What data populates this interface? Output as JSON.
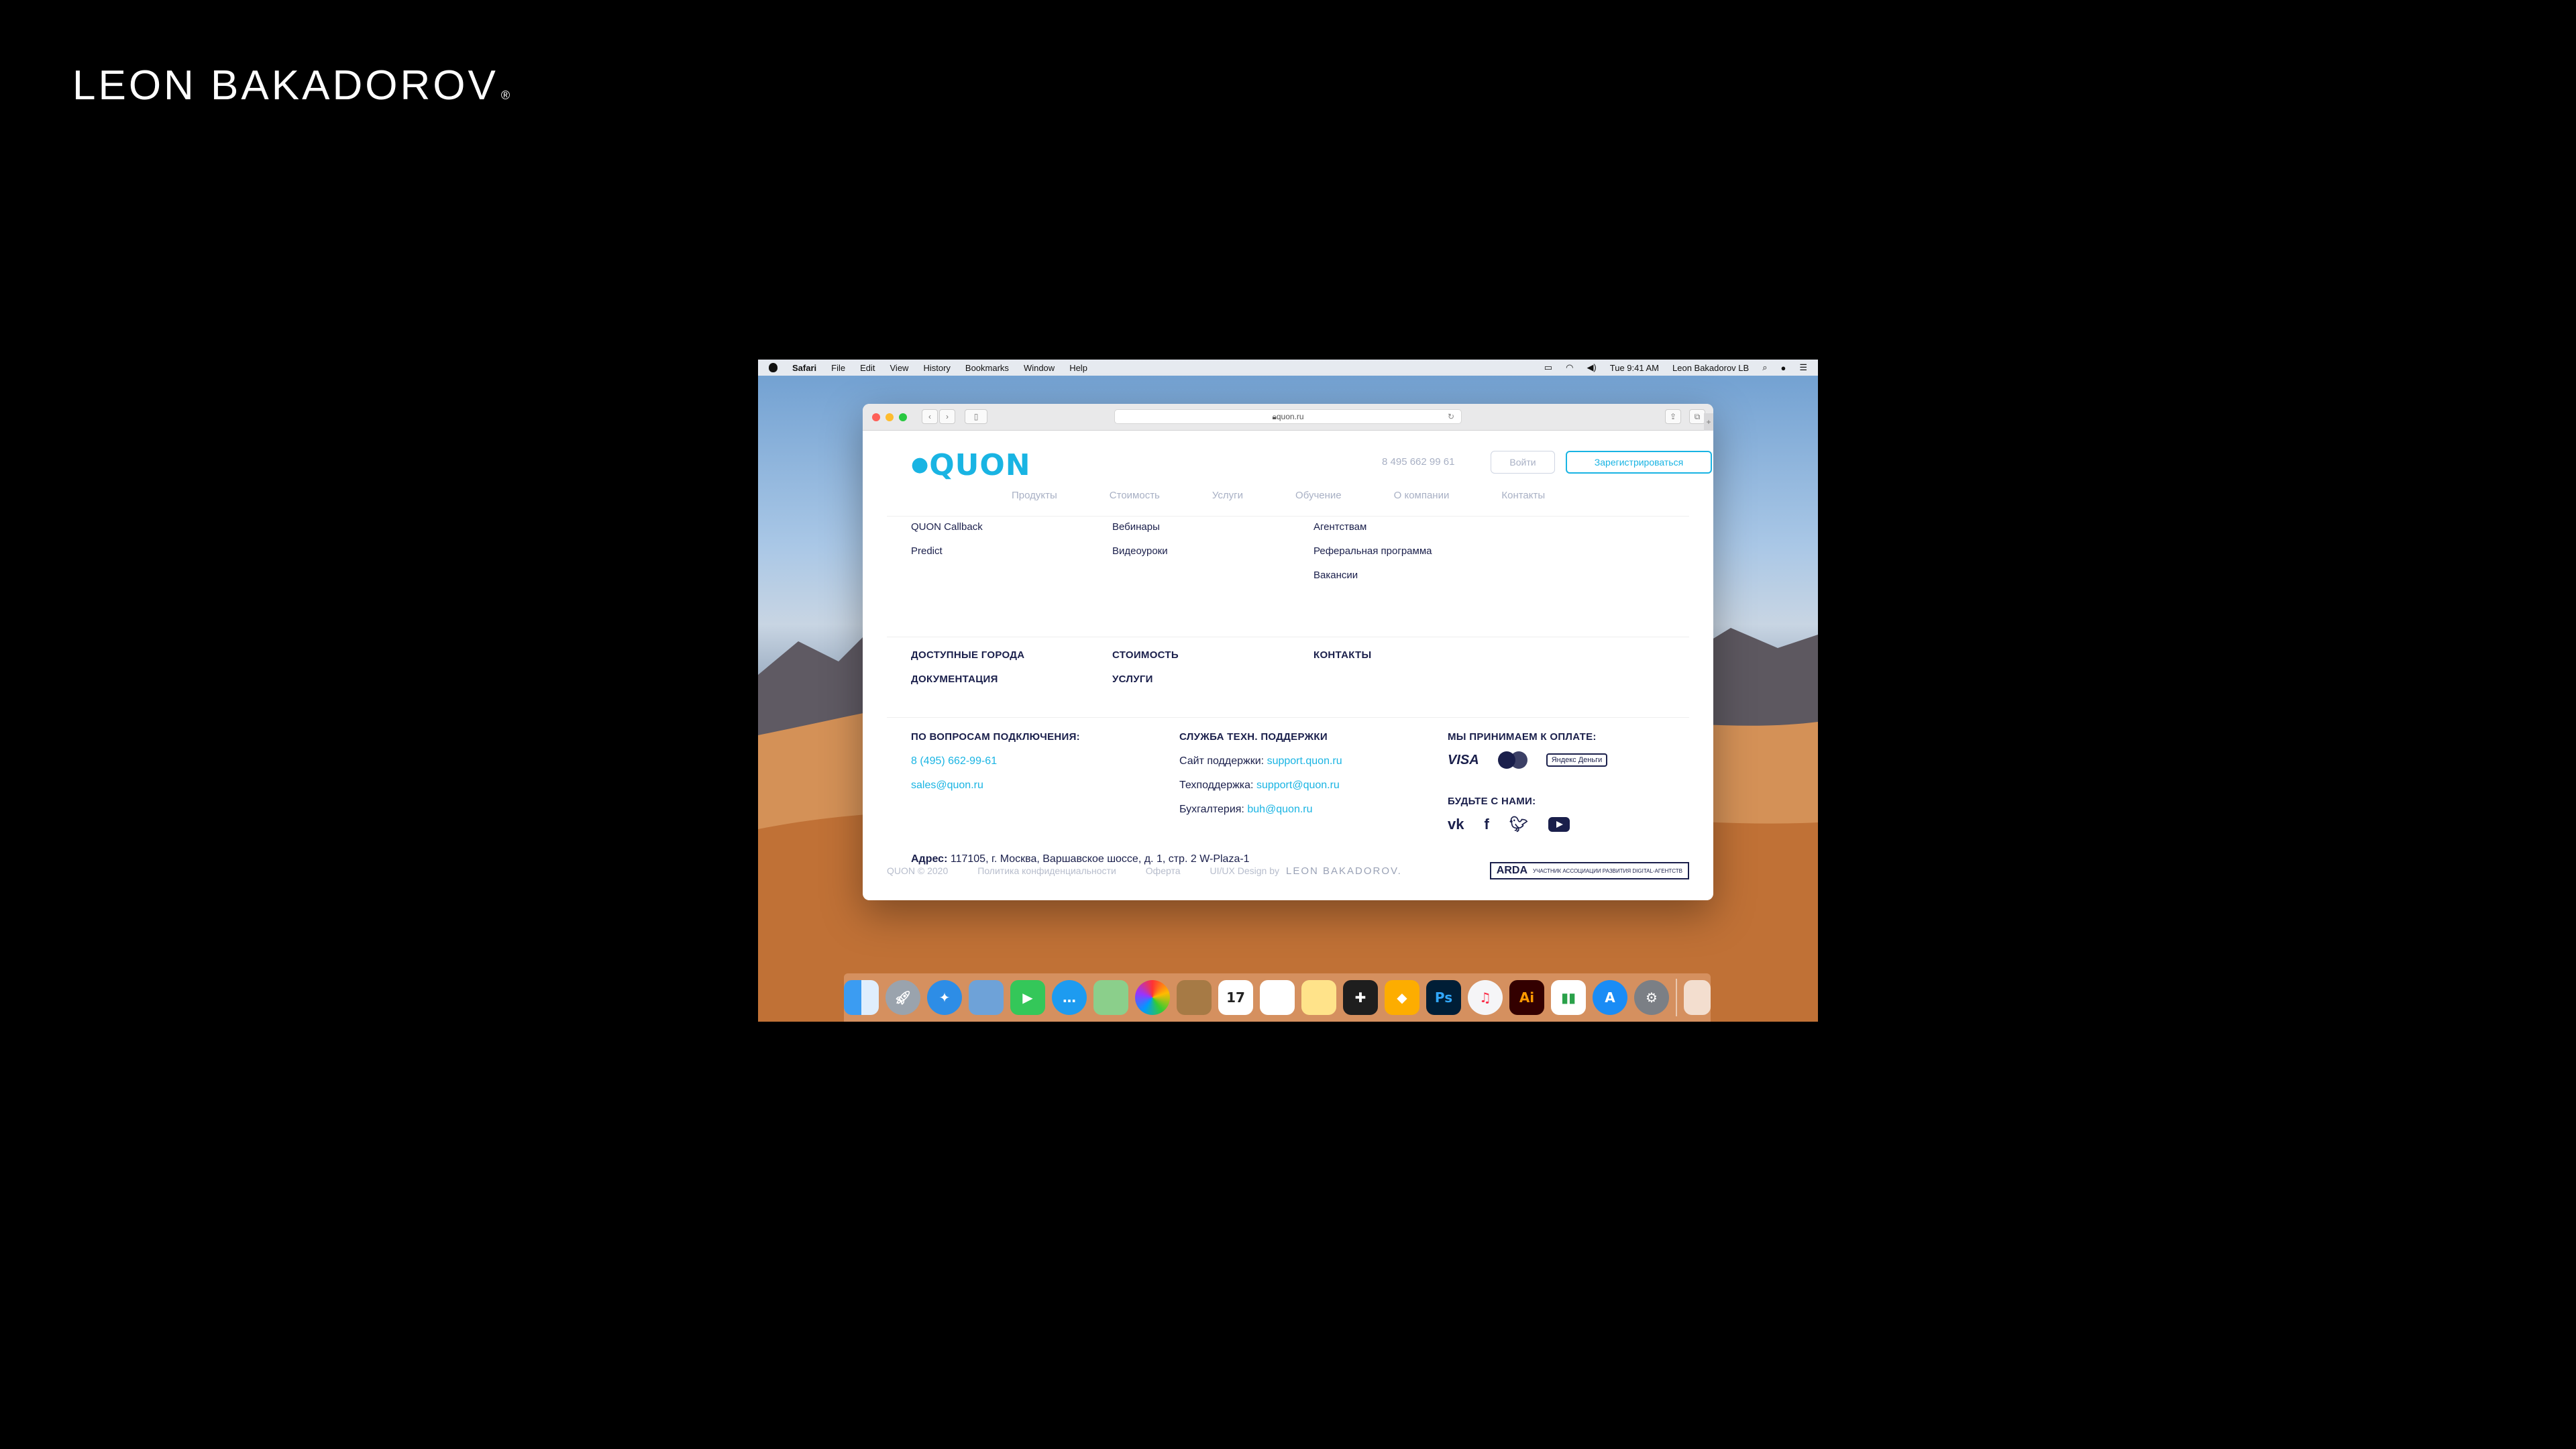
{
  "brand": {
    "name": "LEON BAKADOROV",
    "mark": "®"
  },
  "menubar": {
    "app": "Safari",
    "items": [
      "File",
      "Edit",
      "View",
      "History",
      "Bookmarks",
      "Window",
      "Help"
    ],
    "clock": "Tue 9:41 AM",
    "user": "Leon Bakadorov LB"
  },
  "browser": {
    "url": "quon.ru"
  },
  "site": {
    "logo": "QUON",
    "phone": "8 495 662 99 61",
    "login": "Войти",
    "register": "Зарегистрироваться",
    "nav": [
      "Продукты",
      "Стоимость",
      "Услуги",
      "Обучение",
      "О компании",
      "Контакты"
    ],
    "columns": [
      [
        "QUON Callback",
        "Predict"
      ],
      [
        "Вебинары",
        "Видеоуроки"
      ],
      [
        "Агентствам",
        "Реферальная программа",
        "Вакансии"
      ]
    ],
    "sections": {
      "cities": "ДОСТУПНЫЕ ГОРОДА",
      "docs": "ДОКУМЕНТАЦИЯ",
      "pricing": "СТОИМОСТЬ",
      "services": "УСЛУГИ",
      "contacts": "КОНТАКТЫ"
    },
    "connect": {
      "title": "ПО ВОПРОСАМ ПОДКЛЮЧЕНИЯ:",
      "phone": "8 (495) 662-99-61",
      "email": "sales@quon.ru"
    },
    "support": {
      "title": "СЛУЖБА ТЕХН. ПОДДЕРЖКИ",
      "site_label": "Сайт поддержки:",
      "site_link": "support.quon.ru",
      "tech_label": "Техподдержка:",
      "tech_link": "support@quon.ru",
      "acc_label": "Бухгалтерия:",
      "acc_link": "buh@quon.ru"
    },
    "payment": {
      "title": "МЫ ПРИНИМАЕМ К ОПЛАТЕ:",
      "visa": "VISA",
      "yandex": "Яндекс Деньги"
    },
    "social": {
      "title": "БУДЬТЕ С НАМИ:",
      "vk": "vk",
      "facebook": "f",
      "twitter": "twitter"
    },
    "address": {
      "label": "Адрес:",
      "value": "117105, г. Москва, Варшавское шоссе, д. 1, стр. 2 W-Plaza-1"
    },
    "footer": {
      "copyright": "QUON © 2020",
      "privacy": "Политика конфиденциальности",
      "offer": "Оферта",
      "design": "UI/UX Design by",
      "designer": "LEON BAKADOROV.",
      "arda": "ARDA",
      "arda_sub": "УЧАСТНИК АССОЦИАЦИИ РАЗВИТИЯ DIGITAL-АГЕНТСТВ"
    }
  },
  "dock": {
    "apps": [
      "finder",
      "launchpad",
      "safari",
      "preview",
      "facetime",
      "messages",
      "maps",
      "photos",
      "notes",
      "calendar",
      "reminders",
      "stickies",
      "figma",
      "sketch",
      "Ps",
      "music",
      "Ai",
      "numbers",
      "app-store",
      "system-preferences"
    ],
    "calendar_day": "17"
  }
}
